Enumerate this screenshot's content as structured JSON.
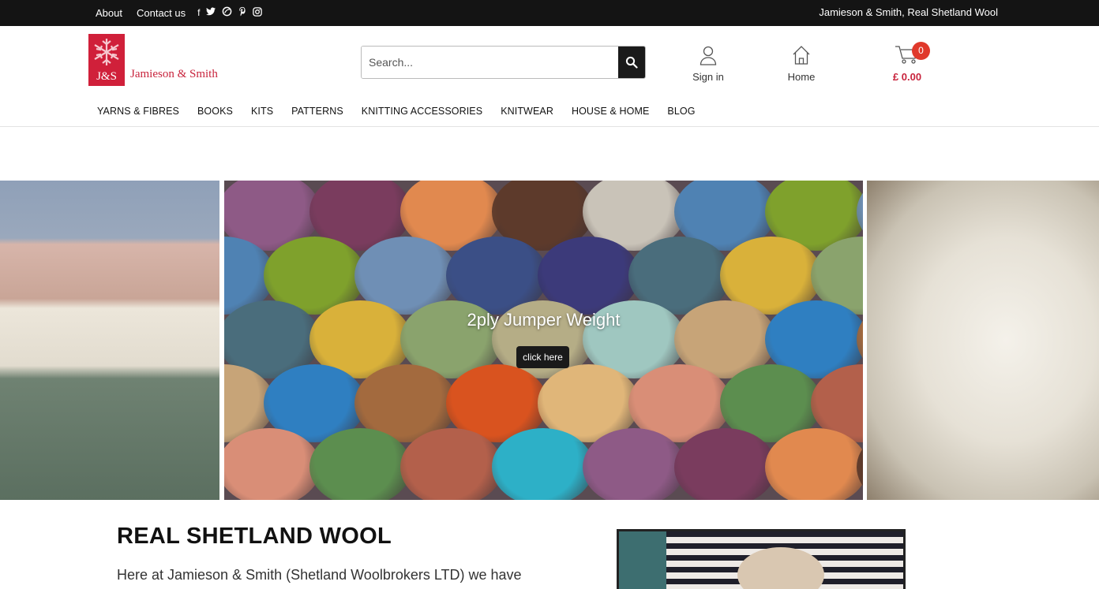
{
  "topbar": {
    "about": "About",
    "contact": "Contact us",
    "tagline": "Jamieson & Smith, Real Shetland Wool",
    "social": [
      "facebook-icon",
      "twitter-icon",
      "ravelry-icon",
      "pinterest-icon",
      "instagram-icon"
    ]
  },
  "header": {
    "logo_monogram": "J&S",
    "logo_name": "Jamieson & Smith",
    "search_placeholder": "Search...",
    "signin_label": "Sign in",
    "home_label": "Home",
    "cart_count": "0",
    "cart_total": "£ 0.00"
  },
  "nav": {
    "items": [
      "YARNS & FIBRES",
      "BOOKS",
      "KITS",
      "PATTERNS",
      "KNITTING ACCESSORIES",
      "KNITWEAR",
      "HOUSE & HOME",
      "BLOG"
    ]
  },
  "slider": {
    "title": "2ply Jumper Weight",
    "button": "click here"
  },
  "content": {
    "heading": "REAL SHETLAND WOOL",
    "intro": "Here at Jamieson & Smith (Shetland Woolbrokers LTD) we have"
  },
  "colors": {
    "brand_red": "#c8243d",
    "topbar_bg": "#141414",
    "badge": "#e0392b"
  }
}
